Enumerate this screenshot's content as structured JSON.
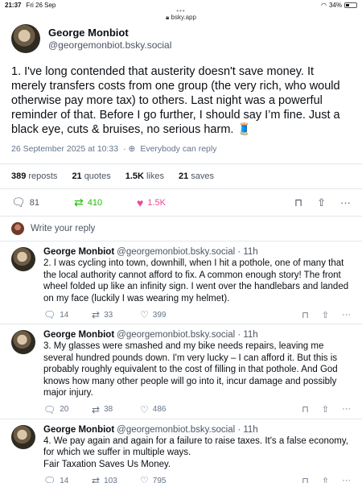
{
  "status_bar": {
    "time": "21:37",
    "date": "Fri 26 Sep",
    "battery": "34%"
  },
  "browser": {
    "url": "bsky.app",
    "dots": "•••"
  },
  "post": {
    "author_name": "George Monbiot",
    "author_handle": "@georgemonbiot.bsky.social",
    "text": "1. I've long contended that austerity doesn't save money. It merely transfers costs from one group (the very rich, who would otherwise pay more tax) to others. Last night was a powerful reminder of that. Before I go further, I should say I’m fine. Just a black eye, cuts & bruises, no serious harm. 🧵",
    "timestamp": "26 September 2025 at 10:33",
    "visibility": "Everybody can reply",
    "stats": {
      "reposts": "389",
      "reposts_label": "reposts",
      "quotes": "21",
      "quotes_label": "quotes",
      "likes": "1.5K",
      "likes_label": "likes",
      "saves": "21",
      "saves_label": "saves"
    },
    "actions": {
      "replies": "81",
      "reposts": "410",
      "likes": "1.5K"
    }
  },
  "reply_prompt": "Write your reply",
  "replies": [
    {
      "name": "George Monbiot",
      "handle": "@georgemonbiot.bsky.social · 11h",
      "text": "2. I was cycling into town, downhill, when I hit a pothole, one of many that the local authority cannot afford to fix. A common enough story! The front wheel folded up like an infinity sign. I went over the handlebars and landed on my face (luckily I was wearing my helmet).",
      "replies": "14",
      "reposts": "33",
      "likes": "399"
    },
    {
      "name": "George Monbiot",
      "handle": "@georgemonbiot.bsky.social · 11h",
      "text": "3. My glasses were smashed and my bike needs repairs, leaving me several hundred pounds down. I'm very lucky – I can afford it. But this is probably roughly equivalent to the cost of filling in that pothole. And God knows how many other people will go into it, incur damage and possibly major injury.",
      "replies": "20",
      "reposts": "38",
      "likes": "486"
    },
    {
      "name": "George Monbiot",
      "handle": "@georgemonbiot.bsky.social · 11h",
      "text": "4. We pay again and again for a failure to raise taxes. It's a false economy, for which we suffer in multiple ways.\nFair Taxation Saves Us Money.",
      "replies": "14",
      "reposts": "103",
      "likes": "795"
    }
  ],
  "colors": {
    "repost_active": "#20bc07",
    "like_active": "#ec4899",
    "muted": "#64748b"
  }
}
